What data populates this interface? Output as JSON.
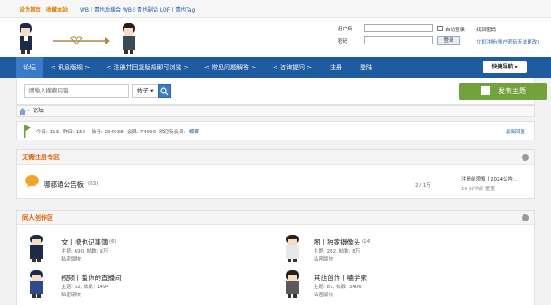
{
  "topbar": {
    "set_home": "设为首页",
    "favorite": "收藏本站",
    "links": "WB丨青也后援会  WB丨青也副话  LOF丨青也Tag"
  },
  "login": {
    "username_label": "用户名",
    "password_label": "密码",
    "auto_login": "自动登录",
    "login_button": "登录",
    "find_password": "找回密码",
    "register_now": "立即注册(账户密码无法更改)"
  },
  "nav": {
    "items": [
      "论坛",
      "< 讯息版规 >",
      "< 注册并回复版规即可浏览 >",
      "< 常见问题解答 >",
      "< 咨询提问 >",
      "注册",
      "登陆"
    ],
    "quick": "快捷导航"
  },
  "search": {
    "placeholder": "请输入搜索内容",
    "type": "帖子",
    "post_button": "发表主题"
  },
  "breadcrumb": {
    "current": "论坛"
  },
  "stats": {
    "today": "今日: 113",
    "yesterday": "昨日: 153",
    "posts": "帖子: 294938",
    "members": "会员: 74090",
    "newest_label": "欢迎新会员:",
    "newest_user": "蝶蝶",
    "latest_reply": "最新回复"
  },
  "sections": [
    {
      "title": "无需注册专区",
      "forums": [
        {
          "name": "哪都通公告板",
          "count": "(83)",
          "ratio": "2 / 1万",
          "last": "注册前须知丨2024公告...",
          "time": "16 分钟前 董董"
        }
      ]
    },
    {
      "title": "同人创作区",
      "forums": [
        {
          "name": "文丨撩也记事簿",
          "count": "(6)",
          "stats": "主题: 690, 帖数: 9万",
          "perm": "私密版块"
        },
        {
          "name": "图丨独家摄像头",
          "count": "(14)",
          "stats": "主题: 282, 帖数: 8万",
          "perm": "私密版块"
        },
        {
          "name": "视频丨蛰你的直播间",
          "count": "",
          "stats": "主题: 32, 帖数: 1494",
          "perm": "私密版块"
        },
        {
          "name": "其他创作丨嗑学家",
          "count": "",
          "stats": "主题: 81, 帖数: 3406",
          "perm": "私密版块"
        }
      ]
    }
  ],
  "colors": {
    "nav": "#1f5b9f",
    "accent": "#e35b00",
    "post": "#72a23a"
  }
}
